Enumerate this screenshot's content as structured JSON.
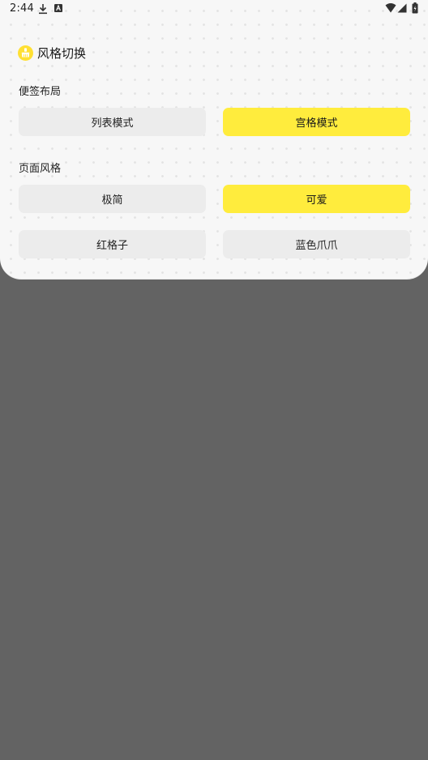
{
  "status_bar": {
    "time": "2:44",
    "icons": [
      "download-icon",
      "notification-a-icon",
      "wifi-icon",
      "signal-icon",
      "battery-icon"
    ]
  },
  "panel": {
    "title": "风格切换",
    "title_icon": "broom-icon",
    "accent_color": "#ffec3d",
    "sections": [
      {
        "label": "便签布局",
        "options": [
          {
            "label": "列表模式",
            "selected": false
          },
          {
            "label": "宫格模式",
            "selected": true
          }
        ]
      },
      {
        "label": "页面风格",
        "options": [
          {
            "label": "极简",
            "selected": false
          },
          {
            "label": "可爱",
            "selected": true
          },
          {
            "label": "红格子",
            "selected": false
          },
          {
            "label": "蓝色爪爪",
            "selected": false
          }
        ]
      }
    ]
  }
}
